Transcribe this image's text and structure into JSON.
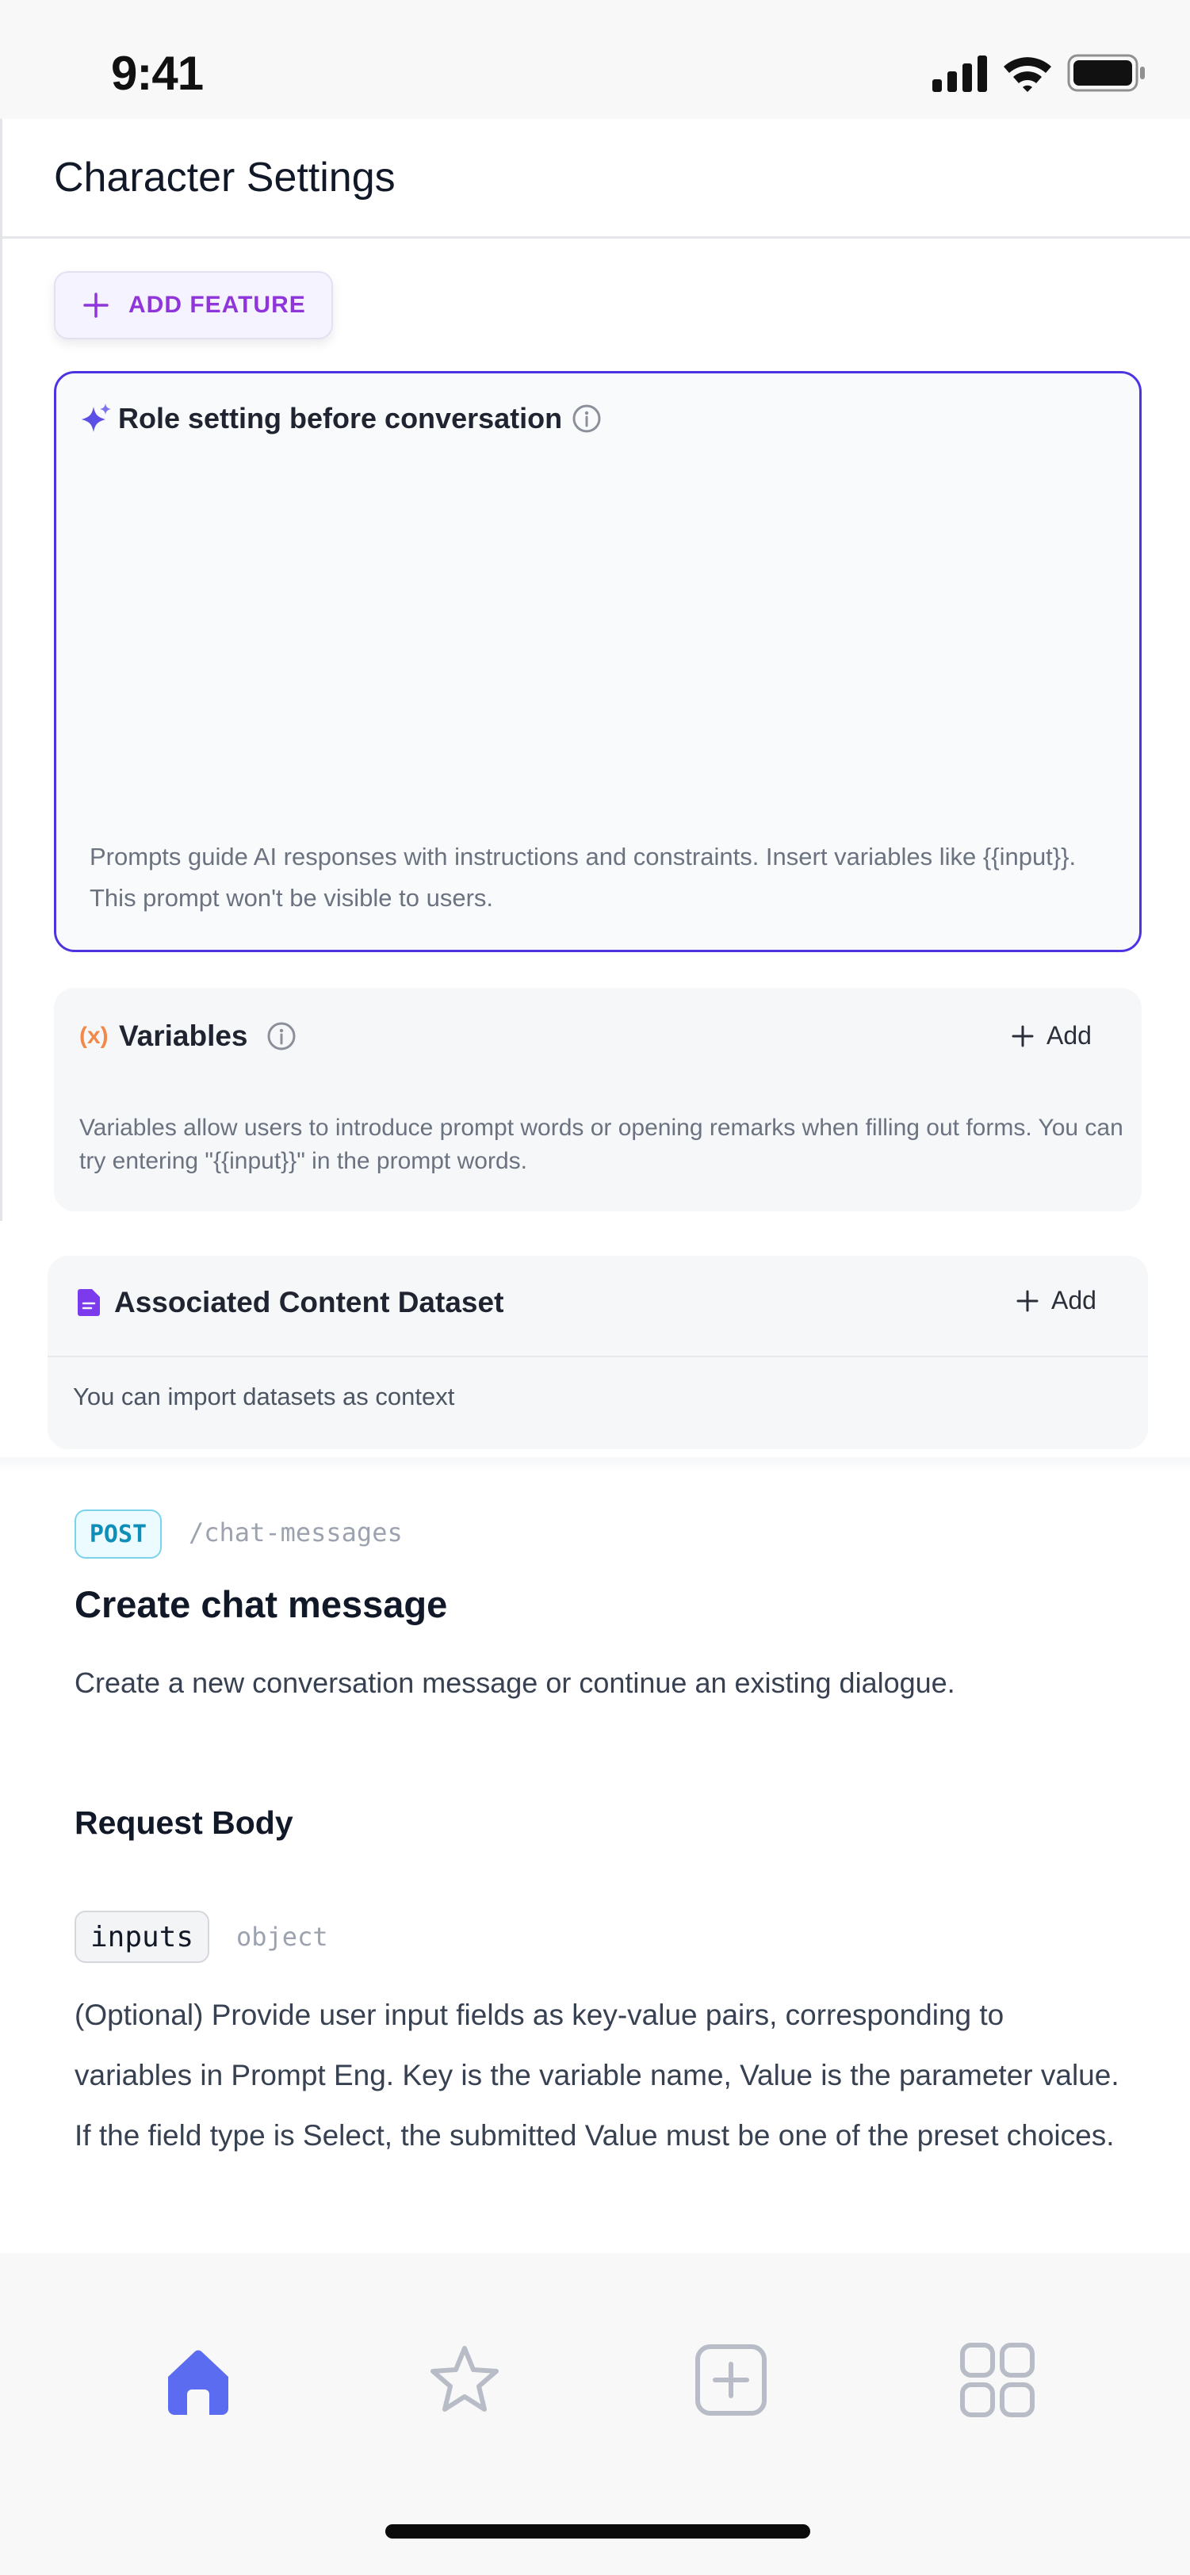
{
  "status_bar": {
    "time": "9:41"
  },
  "header": {
    "title": "Character Settings"
  },
  "add_feature": {
    "label": "ADD FEATURE"
  },
  "prompt_card": {
    "title": "Role setting before conversation",
    "helper": "Prompts guide AI responses with instructions and constraints. Insert variables like {{input}}. This prompt won't be visible to users."
  },
  "variables": {
    "icon_text": "(x)",
    "title": "Variables",
    "add_label": "Add",
    "helper": "Variables allow users to introduce prompt words or opening remarks when filling out forms. You can try entering \"{{input}}\" in the prompt words."
  },
  "dataset": {
    "title": "Associated Content Dataset",
    "add_label": "Add",
    "helper": "You can import datasets as context"
  },
  "api": {
    "method": "POST",
    "endpoint": "/chat-messages",
    "title": "Create chat message",
    "description": "Create a new conversation message or continue an existing dialogue.",
    "request_body_title": "Request Body",
    "param_name": "inputs",
    "param_type": "object",
    "param_description": "(Optional) Provide user input fields as key-value pairs, corresponding to variables in Prompt Eng. Key is the variable name, Value is the parameter value. If the field type is Select, the submitted Value must be one of the preset choices."
  },
  "tab_bar": {
    "tabs": [
      "home-icon",
      "star-icon",
      "add-square-icon",
      "grid-icon"
    ],
    "active_color": "#5b6cf0",
    "inactive_color": "#b7bcc6"
  },
  "colors": {
    "accent_purple": "#8f35d9",
    "prompt_border": "#4c35e0",
    "variables_icon": "#f0894a",
    "dataset_icon": "#7c3aed",
    "post_badge": "#0f8fb8"
  }
}
